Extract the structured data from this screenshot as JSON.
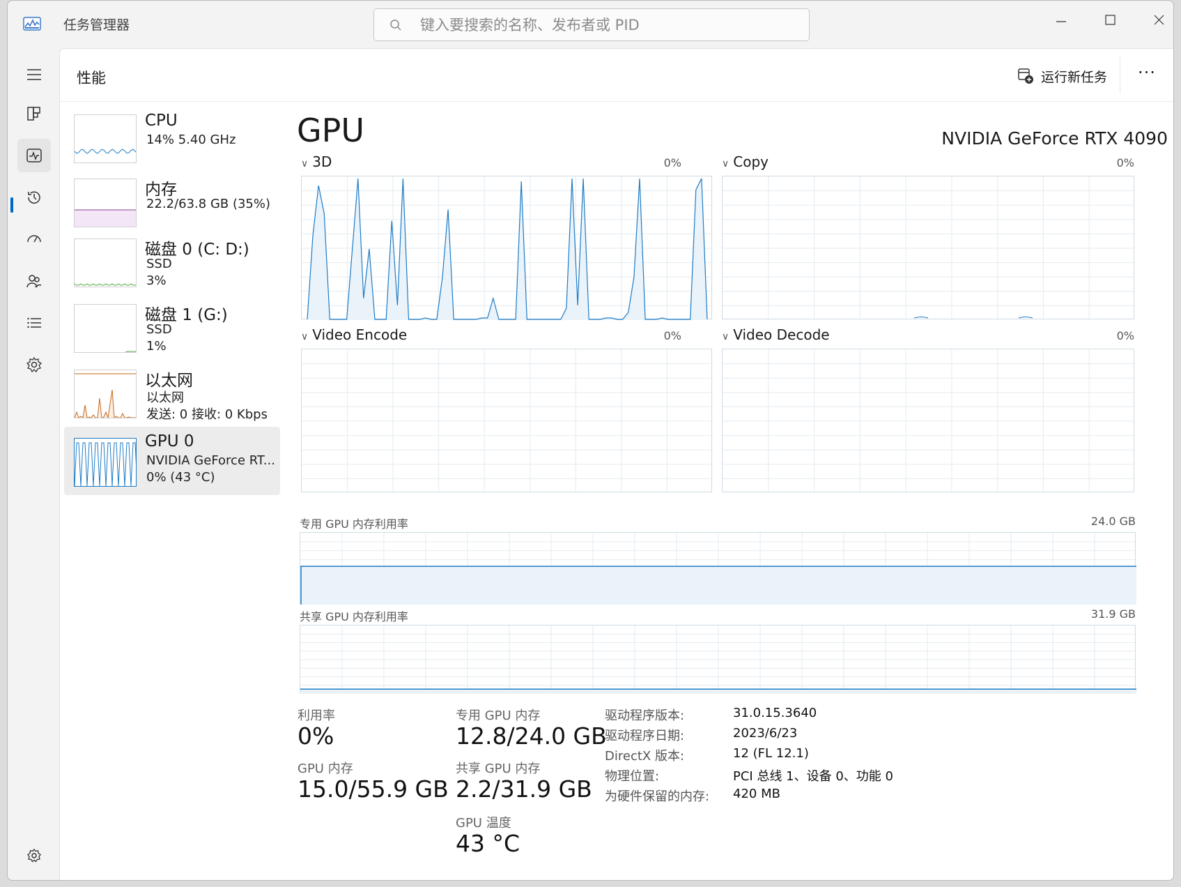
{
  "window": {
    "title": "任务管理器",
    "search_placeholder": "键入要搜索的名称、发布者或 PID"
  },
  "header": {
    "page_title": "性能",
    "run_new_task": "运行新任务",
    "more": "···"
  },
  "sidebar": {
    "items": [
      {
        "name": "CPU",
        "line1": "14%  5.40 GHz",
        "line2": "",
        "color": "#1e7bc4"
      },
      {
        "name": "内存",
        "line1": "22.2/63.8 GB (35%)",
        "line2": "",
        "color": "#8b3d9c"
      },
      {
        "name": "磁盘 0 (C: D:)",
        "line1": "SSD",
        "line2": "3%",
        "color": "#4caa3c"
      },
      {
        "name": "磁盘 1 (G:)",
        "line1": "SSD",
        "line2": "1%",
        "color": "#4caa3c"
      },
      {
        "name": "以太网",
        "line1": "以太网",
        "line2": "发送: 0 接收: 0 Kbps",
        "color": "#c5691f"
      },
      {
        "name": "GPU 0",
        "line1": "NVIDIA GeForce RT...",
        "line2": "0%  (43 °C)",
        "color": "#1e7bc4"
      }
    ]
  },
  "gpu": {
    "title": "GPU",
    "model": "NVIDIA GeForce RTX 4090",
    "engines": [
      {
        "label": "3D",
        "pct": "0%"
      },
      {
        "label": "Copy",
        "pct": "0%"
      },
      {
        "label": "Video Encode",
        "pct": "0%"
      },
      {
        "label": "Video Decode",
        "pct": "0%"
      }
    ],
    "dedicated_mem_label": "专用 GPU 内存利用率",
    "dedicated_mem_max": "24.0 GB",
    "shared_mem_label": "共享 GPU 内存利用率",
    "shared_mem_max": "31.9 GB",
    "dedicated_mem_fraction": 0.533,
    "shared_mem_fraction": 0.069,
    "stats": {
      "utilization_label": "利用率",
      "utilization_value": "0%",
      "dedicated_label": "专用 GPU 内存",
      "dedicated_value": "12.8/24.0 GB",
      "gpu_mem_label": "GPU 内存",
      "gpu_mem_value": "15.0/55.9 GB",
      "shared_label": "共享 GPU 内存",
      "shared_value": "2.2/31.9 GB",
      "temp_label": "GPU 温度",
      "temp_value": "43 °C"
    },
    "info": [
      {
        "label": "驱动程序版本:",
        "value": "31.0.15.3640"
      },
      {
        "label": "驱动程序日期:",
        "value": "2023/6/23"
      },
      {
        "label": "DirectX 版本:",
        "value": "12 (FL 12.1)"
      },
      {
        "label": "物理位置:",
        "value": "PCI 总线 1、设备 0、功能 0"
      },
      {
        "label": "为硬件保留的内存:",
        "value": "420 MB"
      }
    ]
  },
  "chart_data": {
    "type": "area",
    "title": "",
    "ylim": [
      0,
      100
    ],
    "series": [
      {
        "values": [
          0,
          60,
          95,
          75,
          0,
          0,
          0,
          0,
          50,
          100,
          15,
          50,
          0,
          0,
          0,
          70,
          10,
          100,
          0,
          0,
          0,
          1,
          0,
          0,
          30,
          78,
          0,
          0,
          0,
          0,
          0,
          1,
          1,
          15,
          0,
          0,
          0,
          0,
          98,
          0,
          0,
          0,
          0,
          0,
          0,
          0,
          8,
          100,
          10,
          100,
          0,
          0,
          0,
          1,
          1,
          0,
          0,
          5,
          30,
          100,
          0,
          0,
          0,
          1,
          0,
          0,
          0,
          0,
          0,
          92,
          100,
          0
        ]
      }
    ]
  }
}
